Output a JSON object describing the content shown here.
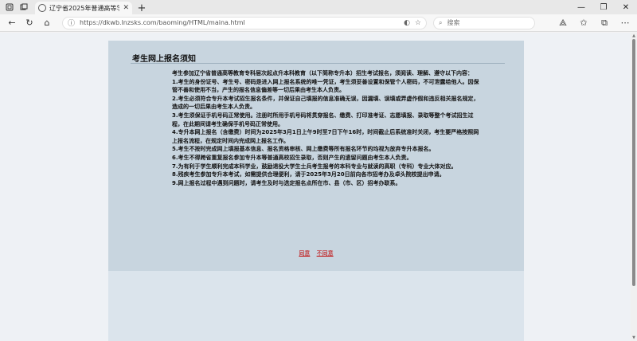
{
  "browser": {
    "tab_title": "辽宁省2025年普通高等学校专升本",
    "url": "https://dkwb.lnzsks.com/baoming/HTML/maina.html",
    "search_placeholder": "搜索",
    "icons": {
      "workspaces": "workspaces-icon",
      "tab_actions": "tab-actions-icon",
      "back": "back-icon",
      "refresh": "refresh-icon",
      "home": "home-icon",
      "info": "info-icon",
      "favorite": "star-icon",
      "search": "search-icon",
      "minimize": "minimize-icon",
      "restore": "restore-icon",
      "close": "close-icon"
    }
  },
  "notice": {
    "title": "考生网上报名须知",
    "intro": "考生参加辽宁省普通高等教育专科层次起点升本科教育（以下简称专升本）招生考试报名，须阅读、理解、遵守以下内容：",
    "items": [
      "1.考生的身份证号、考生号、密码是进入网上报名系统的唯一凭证，考生须妥善设置和保管个人密码，不可泄露给他人。因保管不善和使用不当，产生的报名信息偏差等一切后果由考生本人负责。",
      "2.考生必须符合专升本考试招生报名条件，并保证自己填报的信息准确无误，因漏填、误填或弄虚作假和违反相关报名规定，造成的一切后果由考生本人负责。",
      "3.考生须保证手机号码正常使用。注册时所用手机号码将贯穿报名、缴费、打印准考证、志愿填报、录取等整个考试招生过程，在此期间请考生确保手机号码正常使用。",
      "4.专升本网上报名（含缴费）时间为2025年3月1日上午9时至7日下午16时，时间截止后系统准时关闭，考生要严格按照网上报名流程，在规定时间内完成网上报名工作。",
      "5.考生不按时完成网上填报基本信息、报名资格审核、网上缴费等所有报名环节的均视为放弃专升本报名。",
      "6.考生不得跨省重复报名参加专升本等普通高校招生录取，否则产生的遗留问题由考生本人负责。",
      "7.为有利于学生顺利完成本科学业，鼓励退役大学生士兵考生报考的本科专业与就读的高职（专科）专业大体对应。",
      "8.残疾考生参加专升本考试，如需提供合理便利，请于2025年3月20日前向各市招考办及卓头院校提出申请。",
      "9.网上报名过程中遇到问题时，请考生及时与选定报名点所在市、县（市、区）招考办联系。"
    ],
    "agree_label": "同意",
    "disagree_label": "不同意"
  }
}
